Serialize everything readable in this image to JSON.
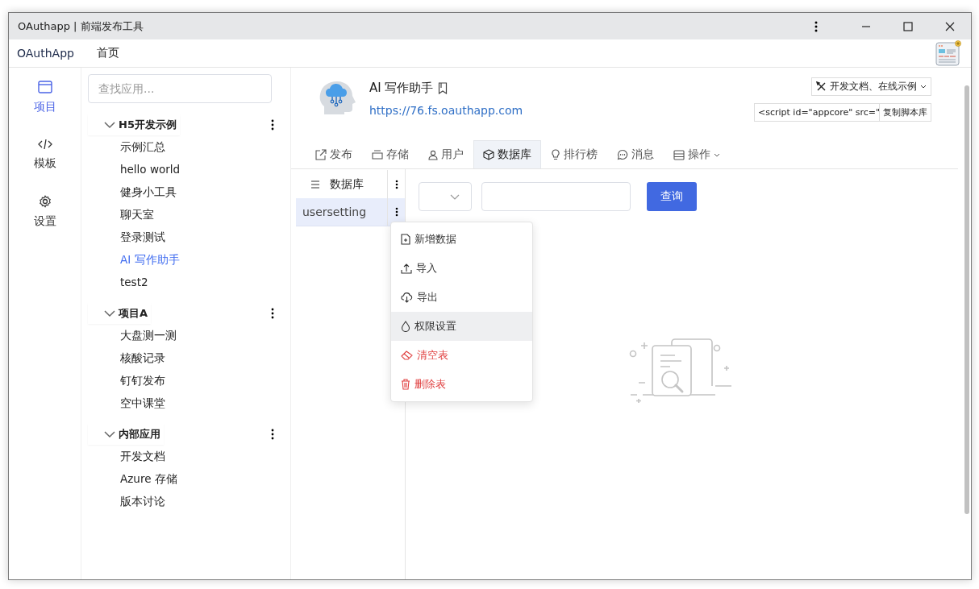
{
  "window": {
    "title": "OAuthapp | 前端发布工具"
  },
  "menu_bar": {
    "brand": "OAuthApp",
    "items": [
      "首页"
    ]
  },
  "nav": [
    {
      "label": "项目",
      "selected": true
    },
    {
      "label": "模板",
      "selected": false
    },
    {
      "label": "设置",
      "selected": false
    }
  ],
  "search": {
    "placeholder": "查找应用..."
  },
  "groups": [
    {
      "name": "H5开发示例",
      "expanded": true,
      "children": [
        {
          "label": "示例汇总",
          "selected": false
        },
        {
          "label": "hello world",
          "selected": false
        },
        {
          "label": "健身小工具",
          "selected": false
        },
        {
          "label": "聊天室",
          "selected": false
        },
        {
          "label": "登录测试",
          "selected": false
        },
        {
          "label": "AI 写作助手",
          "selected": true
        },
        {
          "label": "test2",
          "selected": false
        }
      ]
    },
    {
      "name": "项目A",
      "expanded": true,
      "children": [
        {
          "label": "大盘测一测",
          "selected": false
        },
        {
          "label": "核酸记录",
          "selected": false
        },
        {
          "label": "钉钉发布",
          "selected": false
        },
        {
          "label": "空中课堂",
          "selected": false
        }
      ]
    },
    {
      "name": "内部应用",
      "expanded": true,
      "children": [
        {
          "label": "开发文档",
          "selected": false
        },
        {
          "label": "Azure 存储",
          "selected": false
        },
        {
          "label": "版本讨论",
          "selected": false
        }
      ]
    }
  ],
  "app": {
    "name": "AI 写作助手",
    "url": "https://76.fs.oauthapp.com",
    "docs_button": "开发文档、在线示例",
    "script_snippet": "<script id=\"appcore\" src=\"",
    "copy_button": "复制脚本库"
  },
  "tabs": [
    {
      "label": "发布",
      "selected": false,
      "kind": "plain"
    },
    {
      "label": "存储",
      "selected": false,
      "kind": "plain"
    },
    {
      "label": "用户",
      "selected": false,
      "kind": "plain"
    },
    {
      "label": "数据库",
      "selected": true,
      "kind": "plain"
    },
    {
      "label": "排行榜",
      "selected": false,
      "kind": "plain"
    },
    {
      "label": "消息",
      "selected": false,
      "kind": "plain"
    },
    {
      "label": "操作",
      "selected": false,
      "kind": "menu"
    }
  ],
  "tables": {
    "header": "数据库",
    "items": [
      {
        "name": "usersetting",
        "selected": true
      }
    ]
  },
  "query": {
    "button": "查询"
  },
  "context_menu": [
    {
      "label": "新增数据",
      "kind": "normal",
      "hovered": false
    },
    {
      "label": "导入",
      "kind": "normal",
      "hovered": false
    },
    {
      "label": "导出",
      "kind": "normal",
      "hovered": false
    },
    {
      "label": "权限设置",
      "kind": "normal",
      "hovered": true
    },
    {
      "label": "清空表",
      "kind": "danger",
      "hovered": false
    },
    {
      "label": "删除表",
      "kind": "danger",
      "hovered": false
    }
  ]
}
